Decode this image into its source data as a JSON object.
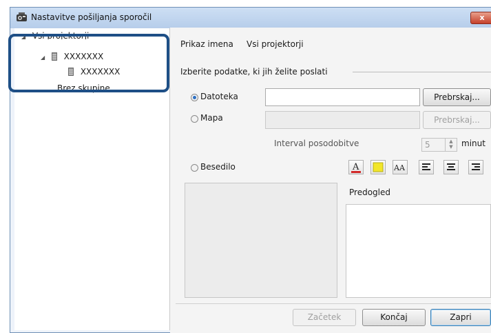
{
  "window": {
    "title": "Nastavitve pošiljanja sporočil",
    "close_label": "x"
  },
  "tree": {
    "root_label": "Vsi projektorji",
    "group_label": "XXXXXXX",
    "child_label": "XXXXXXX",
    "no_group_label": "Brez skupine"
  },
  "display": {
    "label": "Prikaz imena",
    "value": "Vsi projektorji"
  },
  "section": {
    "title": "Izberite podatke, ki jih želite poslati"
  },
  "options": {
    "file_label": "Datoteka",
    "file_value": "",
    "file_browse": "Prebrskaj...",
    "folder_label": "Mapa",
    "folder_value": "",
    "folder_browse": "Prebrskaj...",
    "interval_label": "Interval posodobitve",
    "interval_value": "5",
    "interval_unit": "minut",
    "text_label": "Besedilo",
    "selected": "Datoteka"
  },
  "toolbar": {
    "font_color_icon": "font-color-icon",
    "highlight_icon": "highlight-color-icon",
    "font_size_icon": "font-size-icon",
    "align_left_icon": "align-left-icon",
    "align_center_icon": "align-center-icon",
    "align_right_icon": "align-right-icon",
    "font_color_glyph": "A",
    "font_size_glyph": "AA"
  },
  "preview": {
    "label": "Predogled"
  },
  "buttons": {
    "start": "Začetek",
    "finish": "Končaj",
    "close": "Zapri"
  },
  "colors": {
    "highlight_border": "#1e4f86",
    "font_color_bar": "#d22a2a",
    "highlight_swatch": "#f2e62a"
  }
}
